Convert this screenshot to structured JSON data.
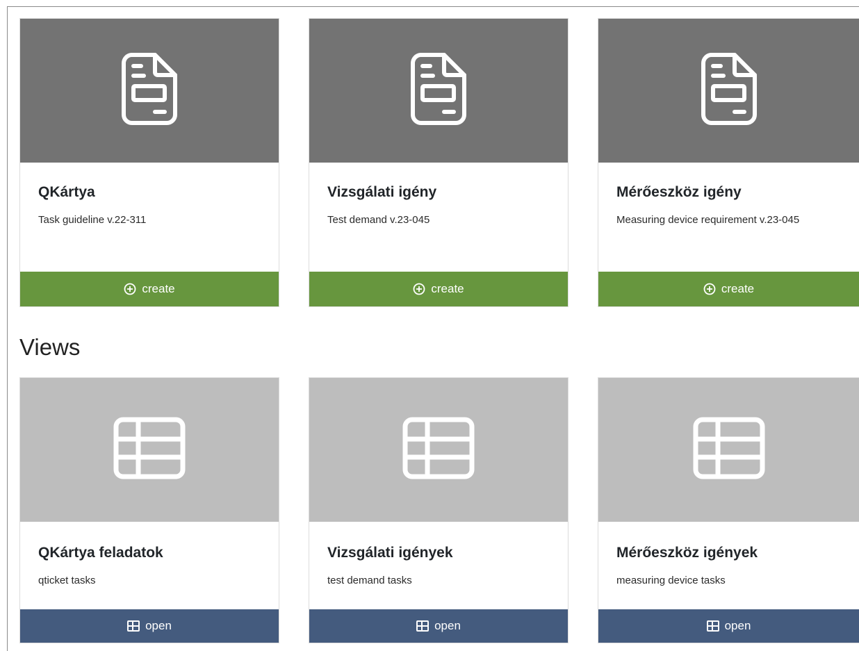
{
  "forms": [
    {
      "title": "QKártya",
      "subtitle": "Task guideline v.22-311",
      "button_label": "create",
      "icon": "document-form-icon"
    },
    {
      "title": "Vizsgálati igény",
      "subtitle": "Test demand v.23-045",
      "button_label": "create",
      "icon": "document-form-icon"
    },
    {
      "title": "Mérőeszköz igény",
      "subtitle": "Measuring device requirement v.23-045",
      "button_label": "create",
      "icon": "document-form-icon"
    }
  ],
  "views_section": {
    "title": "Views"
  },
  "views": [
    {
      "title": "QKártya feladatok",
      "subtitle": "qticket tasks",
      "button_label": "open",
      "icon": "table-icon"
    },
    {
      "title": "Vizsgálati igények",
      "subtitle": "test demand tasks",
      "button_label": "open",
      "icon": "table-icon"
    },
    {
      "title": "Mérőeszköz igények",
      "subtitle": "measuring device tasks",
      "button_label": "open",
      "icon": "table-icon"
    }
  ],
  "colors": {
    "create_button": "#67963e",
    "open_button": "#445b7e",
    "form_header": "#737373",
    "view_header": "#bdbdbd"
  }
}
